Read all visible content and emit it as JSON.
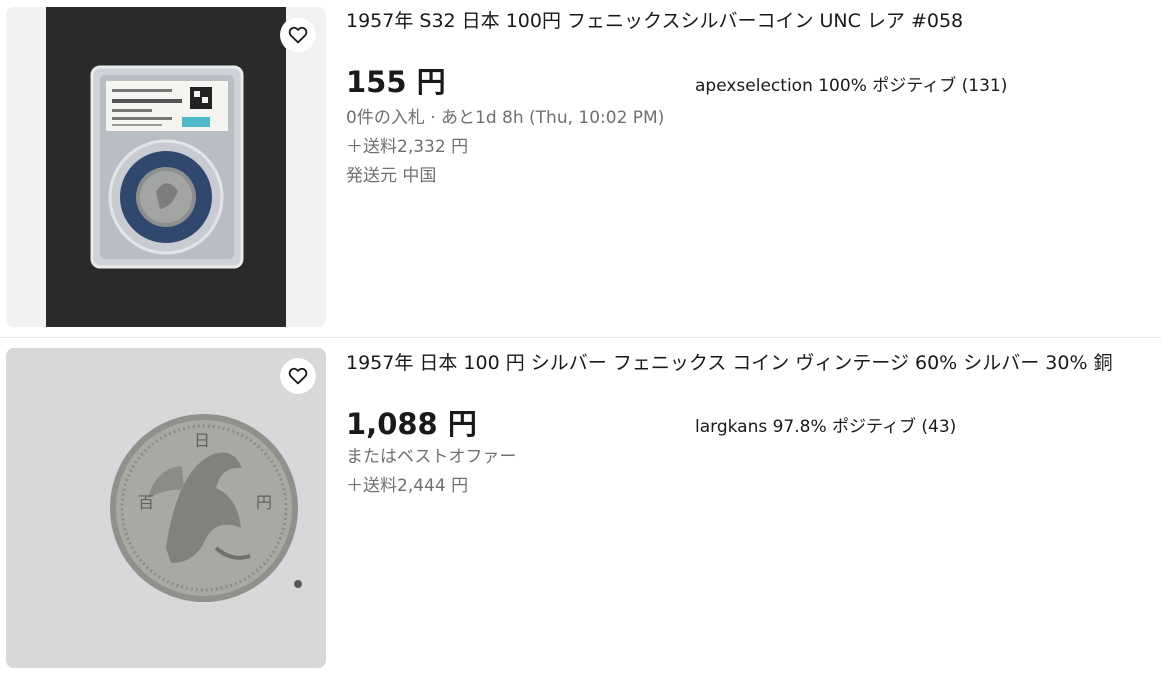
{
  "listings": [
    {
      "title": "1957年 S32 日本 100円 フェニックスシルバーコイン UNC レア #058",
      "price": "155 円",
      "seller": "apexselection 100% ポジティブ (131)",
      "bids_time": "0件の入札 · あと1d 8h (Thu, 10:02 PM)",
      "shipping": "＋送料2,332 円",
      "origin": "発送元 中国"
    },
    {
      "title": "1957年 日本 100 円 シルバー フェニックス コイン ヴィンテージ 60% シルバー 30% 銅",
      "price": "1,088 円",
      "seller": "largkans 97.8% ポジティブ (43)",
      "best_offer": "またはベストオファー",
      "shipping": "＋送料2,444 円"
    }
  ],
  "icons": {
    "watch": "heart-icon"
  }
}
